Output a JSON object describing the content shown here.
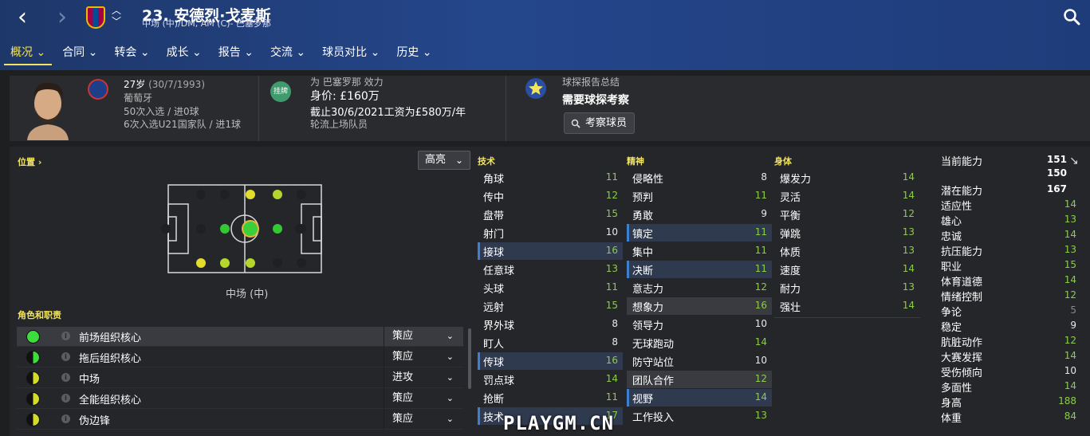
{
  "header": {
    "title": "23. 安德烈·戈麦斯",
    "subtitle": "中场 (中)/DM, AM (C)- 巴塞罗那"
  },
  "menu": [
    {
      "label": "概况"
    },
    {
      "label": "合同"
    },
    {
      "label": "转会"
    },
    {
      "label": "成长"
    },
    {
      "label": "报告"
    },
    {
      "label": "交流"
    },
    {
      "label": "球员对比"
    },
    {
      "label": "历史"
    }
  ],
  "profile": {
    "age": "27岁",
    "dob": "(30/7/1993)",
    "nationality": "葡萄牙",
    "caps": "50次入选 / 进0球",
    "u21_caps": "6次入选U21国家队 / 进1球"
  },
  "contract": {
    "badge": "挂牌",
    "club": "为 巴塞罗那 效力",
    "value": "身价: £160万",
    "wage": "截止30/6/2021工资为£580万/年",
    "status": "轮流上场队员"
  },
  "scout": {
    "heading": "球探报告总结",
    "summary": "需要球探考察",
    "button": "考察球员"
  },
  "position": {
    "title": "位置 ›",
    "highlight": "高亮",
    "label": "中场 (中)"
  },
  "roles": {
    "title": "角色和职责",
    "items": [
      {
        "name": "前场组织核心",
        "duty": "策应"
      },
      {
        "name": "拖后组织核心",
        "duty": "策应"
      },
      {
        "name": "中场",
        "duty": "进攻"
      },
      {
        "name": "全能组织核心",
        "duty": "策应"
      },
      {
        "name": "伪边锋",
        "duty": "策应"
      }
    ]
  },
  "technical": {
    "title": "技术",
    "attrs": [
      {
        "name": "角球",
        "value": "11"
      },
      {
        "name": "传中",
        "value": "12"
      },
      {
        "name": "盘带",
        "value": "15"
      },
      {
        "name": "射门",
        "value": "10"
      },
      {
        "name": "接球",
        "value": "16"
      },
      {
        "name": "任意球",
        "value": "13"
      },
      {
        "name": "头球",
        "value": "11"
      },
      {
        "name": "远射",
        "value": "15"
      },
      {
        "name": "界外球",
        "value": "8"
      },
      {
        "name": "盯人",
        "value": "8"
      },
      {
        "name": "传球",
        "value": "16"
      },
      {
        "name": "罚点球",
        "value": "14"
      },
      {
        "name": "抢断",
        "value": "11"
      },
      {
        "name": "技术",
        "value": "17"
      }
    ]
  },
  "mental": {
    "title": "精神",
    "attrs": [
      {
        "name": "侵略性",
        "value": "8"
      },
      {
        "name": "预判",
        "value": "11"
      },
      {
        "name": "勇敢",
        "value": "9"
      },
      {
        "name": "镇定",
        "value": "11"
      },
      {
        "name": "集中",
        "value": "11"
      },
      {
        "name": "决断",
        "value": "11"
      },
      {
        "name": "意志力",
        "value": "12"
      },
      {
        "name": "想象力",
        "value": "16"
      },
      {
        "name": "领导力",
        "value": "10"
      },
      {
        "name": "无球跑动",
        "value": "14"
      },
      {
        "name": "防守站位",
        "value": "10"
      },
      {
        "name": "团队合作",
        "value": "12"
      },
      {
        "name": "视野",
        "value": "14"
      },
      {
        "name": "工作投入",
        "value": "13"
      }
    ]
  },
  "physical": {
    "title": "身体",
    "attrs": [
      {
        "name": "爆发力",
        "value": "14"
      },
      {
        "name": "灵活",
        "value": "14"
      },
      {
        "name": "平衡",
        "value": "12"
      },
      {
        "name": "弹跳",
        "value": "13"
      },
      {
        "name": "体质",
        "value": "13"
      },
      {
        "name": "速度",
        "value": "14"
      },
      {
        "name": "耐力",
        "value": "13"
      },
      {
        "name": "强壮",
        "value": "14"
      }
    ]
  },
  "abilities": [
    {
      "name": "当前能力",
      "value": "151"
    },
    {
      "name": "",
      "value": "150"
    },
    {
      "name": "潜在能力",
      "value": "167"
    },
    {
      "name": "适应性",
      "value": "14"
    },
    {
      "name": "雄心",
      "value": "13"
    },
    {
      "name": "忠诚",
      "value": "14"
    },
    {
      "name": "抗压能力",
      "value": "13"
    },
    {
      "name": "职业",
      "value": "15"
    },
    {
      "name": "体育道德",
      "value": "14"
    },
    {
      "name": "情绪控制",
      "value": "12"
    },
    {
      "name": "争论",
      "value": "5"
    },
    {
      "name": "稳定",
      "value": "9"
    },
    {
      "name": "肮脏动作",
      "value": "12"
    },
    {
      "name": "大赛发挥",
      "value": "14"
    },
    {
      "name": "受伤倾向",
      "value": "10"
    },
    {
      "name": "多面性",
      "value": "14"
    },
    {
      "name": "身高",
      "value": "188"
    },
    {
      "name": "体重",
      "value": "84"
    }
  ],
  "watermark": "PLAYGM.CN",
  "colors": {
    "accent_yellow": "#f2e45b",
    "attr_high": "#8ccc4b",
    "role_green": "#3cdc3c",
    "role_yellow": "#d4dc2a"
  }
}
